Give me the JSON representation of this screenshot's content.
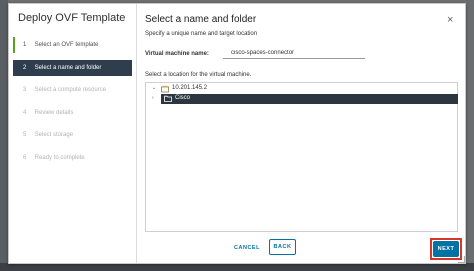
{
  "dialog": {
    "title": "Deploy OVF Template",
    "close_glyph": "×"
  },
  "steps": [
    {
      "num": "1",
      "label": "Select an OVF template",
      "state": "done"
    },
    {
      "num": "2",
      "label": "Select a name and folder",
      "state": "active"
    },
    {
      "num": "3",
      "label": "Select a compute resource",
      "state": "pending"
    },
    {
      "num": "4",
      "label": "Review details",
      "state": "pending"
    },
    {
      "num": "5",
      "label": "Select storage",
      "state": "pending"
    },
    {
      "num": "6",
      "label": "Ready to complete",
      "state": "pending"
    }
  ],
  "main": {
    "heading": "Select a name and folder",
    "subtitle": "Specify a unique name and target location",
    "vm_name_label": "Virtual machine name:",
    "vm_name_value": "cisco-spaces-connector",
    "location_label": "Select a location for the virtual machine."
  },
  "tree": {
    "root_caret": "⌄",
    "root_label": "10.201.145.2",
    "root_icon": "datacenter-icon",
    "child_caret": "›",
    "child_label": "Cisco",
    "child_icon": "folder-icon"
  },
  "buttons": {
    "cancel": "CANCEL",
    "back": "BACK",
    "next": "NEXT"
  },
  "colors": {
    "accent": "#0072a3",
    "active_step_bg": "#2e3e4d",
    "selected_row_bg": "#2b3640",
    "done_step_marker": "#5aa220",
    "highlight_border": "#d9362a"
  }
}
